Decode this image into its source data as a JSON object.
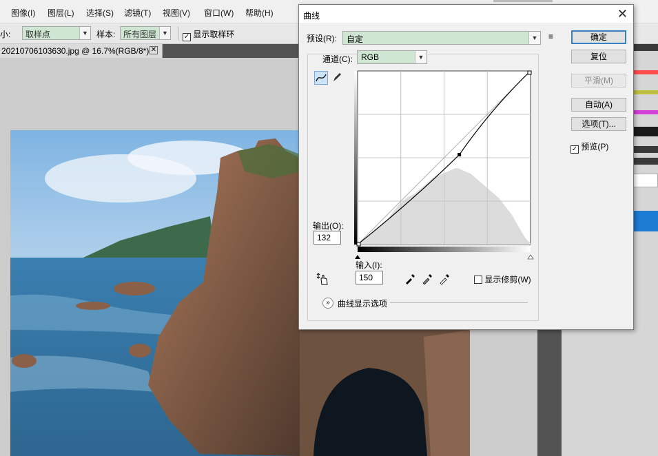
{
  "menubar": {
    "items": [
      "图像(I)",
      "图层(L)",
      "选择(S)",
      "滤镜(T)",
      "视图(V)",
      "窗口(W)",
      "帮助(H)"
    ]
  },
  "options_bar": {
    "size_label_fragment": "小:",
    "sample_size_value": "取样点",
    "sample_label": "样本:",
    "sample_value": "所有图层",
    "show_ring_label": "显示取样环"
  },
  "document_tab": {
    "title": "20210706103630.jpg @ 16.7%(RGB/8*)"
  },
  "dialog": {
    "title": "曲线",
    "preset_label": "预设(R):",
    "preset_value": "自定",
    "channel_label": "通道(C):",
    "channel_value": "RGB",
    "output_label": "输出(O):",
    "output_value": "132",
    "input_label": "输入(I):",
    "input_value": "150",
    "show_clipping_label": "显示修剪(W)",
    "curve_display_options_label": "曲线显示选项",
    "buttons": {
      "ok": "确定",
      "reset": "复位",
      "smooth": "平滑(M)",
      "auto": "自动(A)",
      "options": "选项(T)..."
    },
    "preview_label": "预览(P)",
    "preview_checked": true,
    "show_clipping_checked": false
  },
  "curve": {
    "input": 150,
    "output": 132,
    "histogram_color": "#dcdcdc"
  },
  "colors": {
    "combo_bg": "#cfe7d2",
    "dialog_bg": "#f0f0f0",
    "default_border": "#3c7fc0",
    "panel_highlight": "#1e7bd2"
  }
}
